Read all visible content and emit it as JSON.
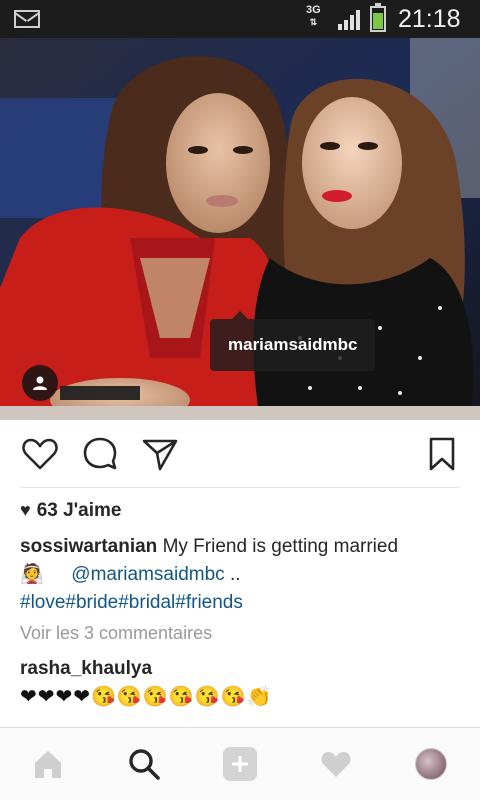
{
  "status_bar": {
    "network": "3G",
    "network_arrows": "⇅",
    "time": "21:18",
    "icons": [
      "mail-icon",
      "signal-icon",
      "battery-icon"
    ]
  },
  "photo": {
    "tag_label": "mariamsaidmbc",
    "user_tag_icon": "person-icon"
  },
  "actions": {
    "icons": [
      "heart-icon",
      "comment-icon",
      "share-icon",
      "bookmark-icon"
    ]
  },
  "post": {
    "likes_count": "63 J'aime",
    "caption_user": "sossiwartanian",
    "caption_text": "My Friend is getting married",
    "caption_emoji": "👰",
    "caption_mention": "@mariamsaidmbc",
    "caption_suffix": "..",
    "caption_hashtags": "#love#bride#bridal#friends",
    "view_comments": "Voir les 3 commentaires"
  },
  "comment": {
    "user": "rasha_khaulya",
    "text": "❤❤❤❤😘😘😘😘😘😘👏"
  },
  "bottom_nav": {
    "items": [
      "home-icon",
      "search-icon",
      "add-icon",
      "activity-heart-icon",
      "profile-avatar"
    ]
  },
  "colors": {
    "status_bar_bg": "#1c1c1c",
    "link": "#125688",
    "muted": "#999999",
    "text": "#262626"
  }
}
